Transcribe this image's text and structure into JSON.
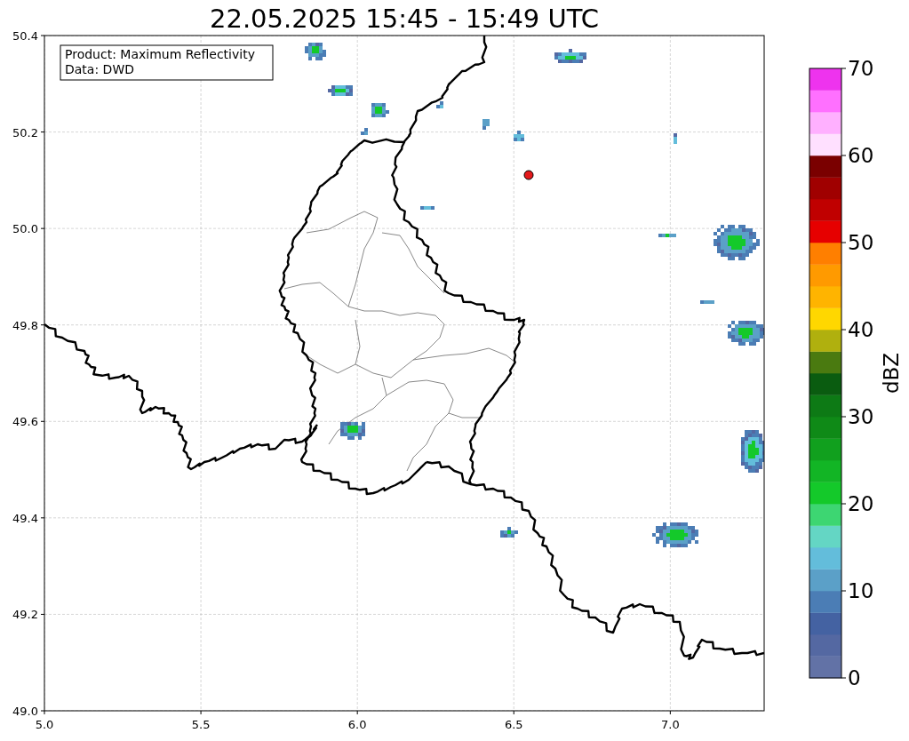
{
  "title": "22.05.2025 15:45 - 15:49 UTC",
  "info_box": {
    "lines": [
      "Product: Maximum Reflectivity",
      "Data: DWD"
    ]
  },
  "map": {
    "x_ticks": [
      "5.0",
      "5.5",
      "6.0",
      "6.5",
      "7.0"
    ],
    "y_ticks": [
      "50.4",
      "50.2",
      "50.0",
      "49.8",
      "49.6",
      "49.4",
      "49.2",
      "49.0"
    ]
  },
  "colorbar": {
    "label": "dBZ",
    "ticks": [
      "70",
      "60",
      "50",
      "40",
      "30",
      "20",
      "10",
      "0"
    ],
    "bins": [
      {
        "color": "#6272a6"
      },
      {
        "color": "#5468a2"
      },
      {
        "color": "#4462a2"
      },
      {
        "color": "#4b7db5"
      },
      {
        "color": "#5ba0c8"
      },
      {
        "color": "#63bddb"
      },
      {
        "color": "#64d6c4"
      },
      {
        "color": "#3dd672"
      },
      {
        "color": "#14c92a"
      },
      {
        "color": "#12b525"
      },
      {
        "color": "#11a01e"
      },
      {
        "color": "#0f8a17"
      },
      {
        "color": "#0d7a15"
      },
      {
        "color": "#0a5c10"
      },
      {
        "color": "#4a7a10"
      },
      {
        "color": "#b0b00e"
      },
      {
        "color": "#ffd700"
      },
      {
        "color": "#ffb400"
      },
      {
        "color": "#ff9a00"
      },
      {
        "color": "#ff7f00"
      },
      {
        "color": "#e60000"
      },
      {
        "color": "#c00000"
      },
      {
        "color": "#a00000"
      },
      {
        "color": "#7a0000"
      },
      {
        "color": "#ffe0ff"
      },
      {
        "color": "#ffb0ff"
      },
      {
        "color": "#ff70ff"
      },
      {
        "color": "#ee33ee"
      }
    ]
  }
}
